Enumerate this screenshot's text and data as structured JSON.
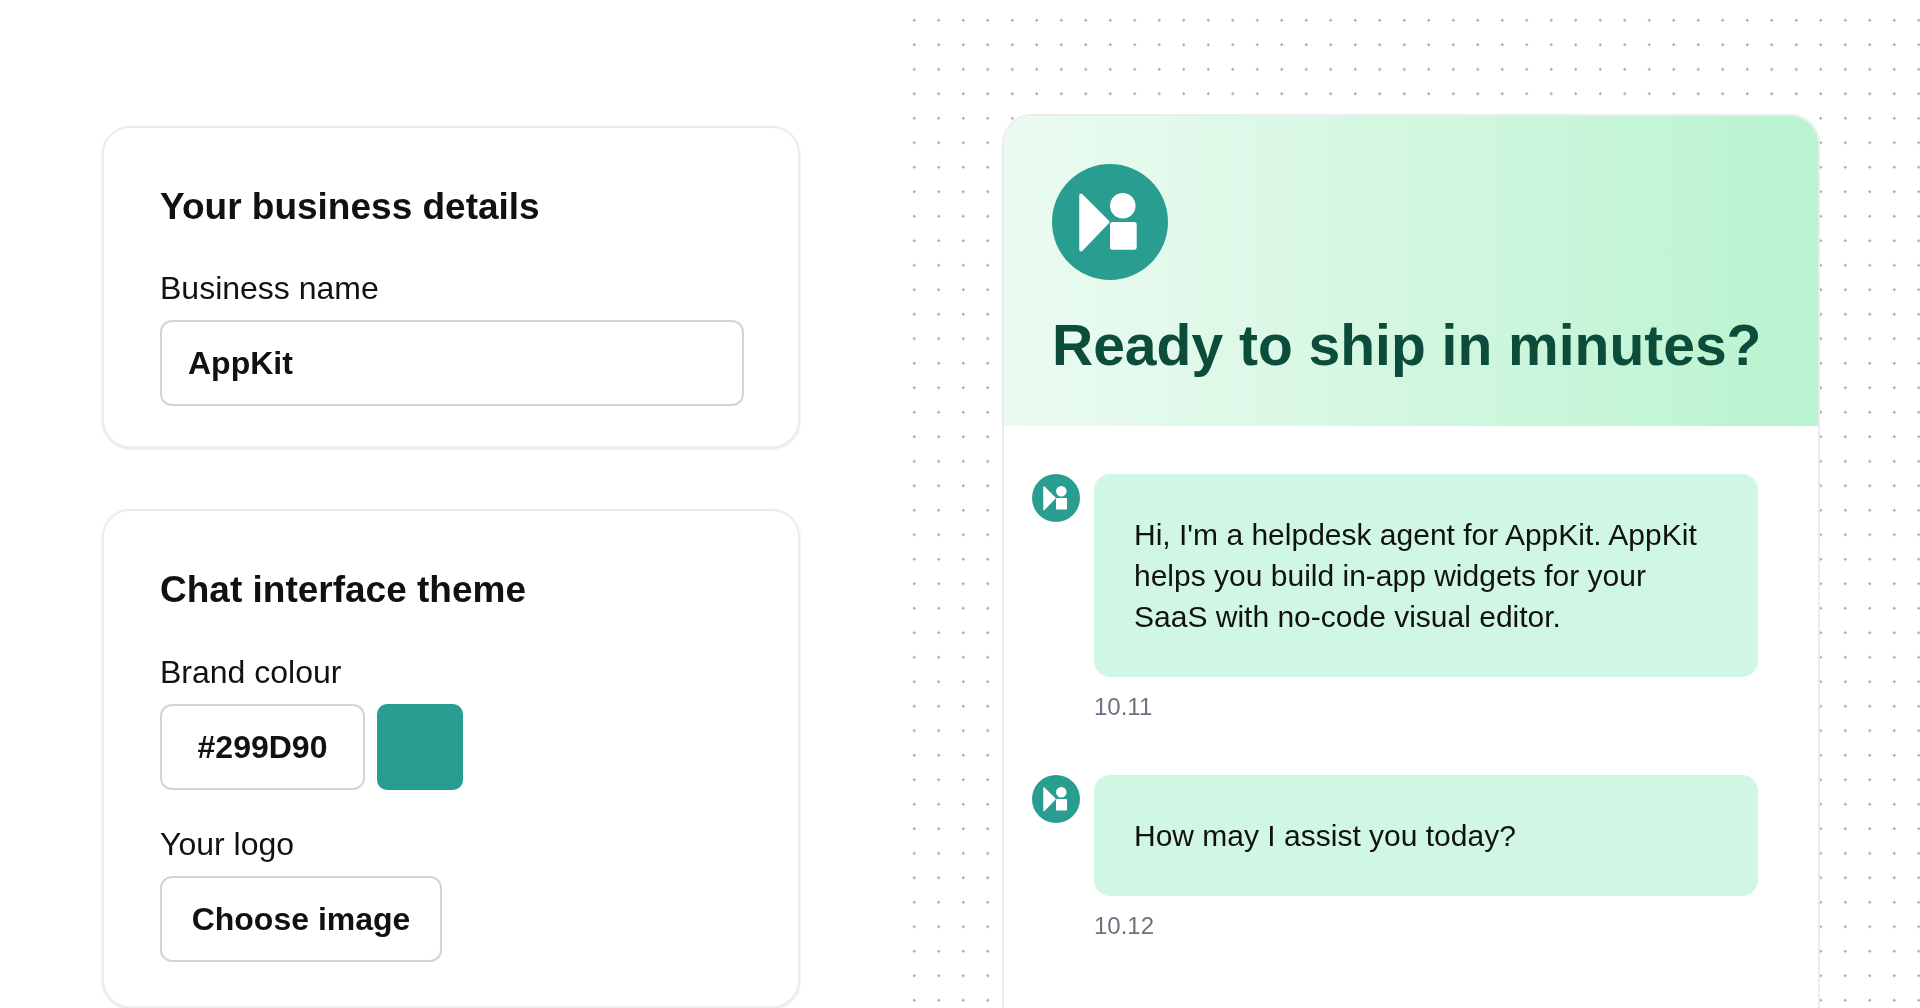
{
  "business_card": {
    "title": "Your business details",
    "field": {
      "label": "Business name",
      "value": "AppKit"
    }
  },
  "theme_card": {
    "title": "Chat interface theme",
    "brand_colour": {
      "label": "Brand colour",
      "value": "#299D90"
    },
    "logo": {
      "label": "Your logo",
      "button": "Choose image"
    }
  },
  "chat_preview": {
    "title": "Ready to ship in minutes?",
    "messages": [
      {
        "text": "Hi, I'm a helpdesk agent for AppKit. AppKit helps you build in-app widgets for your SaaS with no-code visual editor.",
        "time": "10.11"
      },
      {
        "text": "How may I assist you today?",
        "time": "10.12"
      }
    ]
  }
}
